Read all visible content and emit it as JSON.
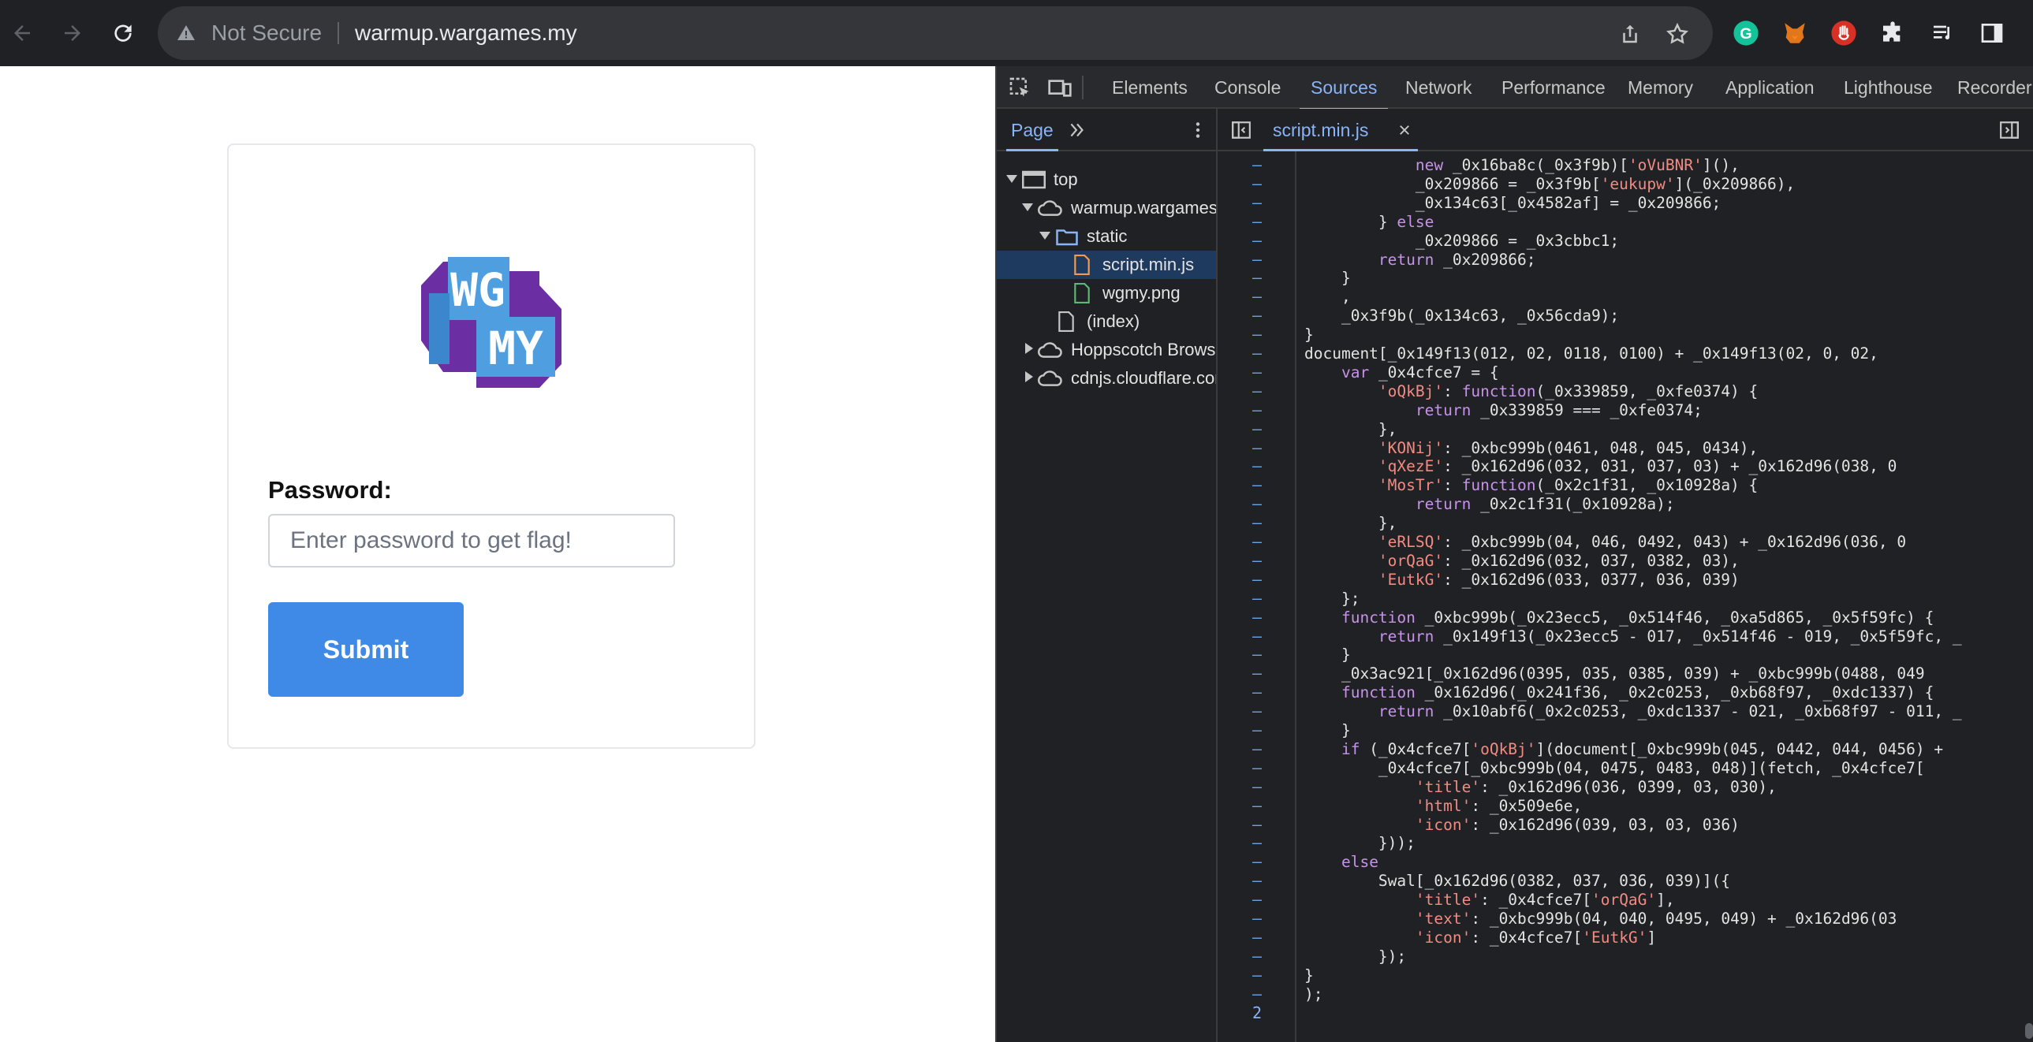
{
  "browser": {
    "security_label": "Not Secure",
    "url": "warmup.wargames.my"
  },
  "page": {
    "logo_alt": "WG MY",
    "password_label": "Password:",
    "password_placeholder": "Enter password to get flag!",
    "submit_label": "Submit"
  },
  "devtools": {
    "tabs": [
      "Elements",
      "Console",
      "Sources",
      "Network",
      "Performance",
      "Memory",
      "Application",
      "Lighthouse",
      "Recorder"
    ],
    "active_tab": "Sources",
    "navigator": {
      "tab_label": "Page",
      "tree": [
        {
          "label": "top",
          "depth": 0,
          "icon": "frame-icon",
          "expanded": true
        },
        {
          "label": "warmup.wargames.",
          "depth": 1,
          "icon": "cloud-icon",
          "expanded": true
        },
        {
          "label": "static",
          "depth": 2,
          "icon": "folder-icon",
          "expanded": true
        },
        {
          "label": "script.min.js",
          "depth": 3,
          "icon": "js-file-icon",
          "selected": true
        },
        {
          "label": "wgmy.png",
          "depth": 3,
          "icon": "image-file-icon"
        },
        {
          "label": "(index)",
          "depth": 2,
          "icon": "document-file-icon"
        },
        {
          "label": "Hoppscotch Brows",
          "depth": 1,
          "icon": "cloud-icon",
          "expanded": false
        },
        {
          "label": "cdnjs.cloudflare.com",
          "depth": 1,
          "icon": "cloud-icon",
          "expanded": false
        }
      ]
    },
    "editor": {
      "open_file": "script.min.js",
      "last_line_number": "2"
    },
    "code": [
      "            new _0x16ba8c(_0x3f9b)['oVuBNR'](),",
      "            _0x209866 = _0x3f9b['eukupw'](_0x209866),",
      "            _0x134c63[_0x4582af] = _0x209866;",
      "        } else",
      "            _0x209866 = _0x3cbbc1;",
      "        return _0x209866;",
      "    }",
      "    ,",
      "    _0x3f9b(_0x134c63, _0x56cda9);",
      "}",
      "document[_0x149f13(0x12d, 0xd2, 0x118, 0x100) + _0x149f13(0xf2, 0xeb, 0xe2,",
      "    var _0x4cfce7 = {",
      "        'oQkBj': function(_0x339859, _0xfe0374) {",
      "            return _0x339859 === _0xfe0374;",
      "        },",
      "        'KONij': _0xbc999b(0x461, 0x48a, 0x45f, 0x434),",
      "        'qXezE': _0x162d96(0x3d2, 0x3e1, 0x3e7, 0x3bb) + _0x162d96(0x38b, 0",
      "        'MosTr': function(_0x2c1f31, _0x10928a) {",
      "            return _0x2c1f31(_0x10928a);",
      "        },",
      "        'eRLSQ': _0xbc999b(0x4af, 0x46e, 0x492, 0x4a3) + _0x162d96(0x36a, 0",
      "        'orQaG': _0x162d96(0x3d2, 0x3c7, 0x382, 0x3ad),",
      "        'EutkG': _0x162d96(0x3b3, 0x377, 0x36c, 0x39a)",
      "    };",
      "    function _0xbc999b(_0x23ecc5, _0x514f46, _0xa5d865, _0x5f59fc) {",
      "        return _0x149f13(_0x23ecc5 - 0x17b, _0x514f46 - 0x1e9, _0x5f59fc, _",
      "    }",
      "    _0x3ac921[_0x162d96(0x395, 0x3a5, 0x385, 0x39c) + _0xbc999b(0x488, 0x49",
      "    function _0x162d96(_0x241f36, _0x2c0253, _0xb68f97, _0xdc1337) {",
      "        return _0x10abf6(_0x2c0253, _0xdc1337 - 0x21b, _0xb68f97 - 0x11a, _",
      "    }",
      "    if (_0x4cfce7['oQkBj'](document[_0xbc999b(0x45f, 0x442, 0x44b, 0x456) +",
      "        _0x4cfce7[_0xbc999b(0x4ab, 0x475, 0x483, 0x48f)](fetch, _0x4cfce7['",
      "            'title': _0x162d96(0x3b6, 0x399, 0x3ca, 0x3b0),",
      "            'html': _0x509e6e,",
      "            'icon': _0x162d96(0x3a9, 0x3ea, 0x3eb, 0x3c6)",
      "        }));",
      "    else",
      "        Swal[_0x162d96(0x382, 0x3c7, 0x3d6, 0x3a9)]({",
      "            'title': _0x4cfce7['orQaG'],",
      "            'text': _0xbc999b(0x4af, 0x4a0, 0x495, 0x4b9) + _0x162d96(0x3bc",
      "            'icon': _0x4cfce7['EutkG']",
      "        });",
      "}",
      ");",
      ""
    ]
  },
  "colors": {
    "chrome_bg": "#202124",
    "omnibox_bg": "#35363a",
    "submit_bg": "#3f8ae6",
    "devtools_accent": "#8ab4f8",
    "logo_blue": "#5aa9e6",
    "logo_purple": "#6b2fa3"
  }
}
